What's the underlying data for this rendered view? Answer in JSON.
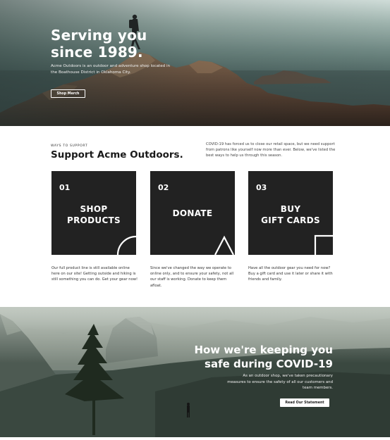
{
  "hero": {
    "title_line1": "Serving you",
    "title_line2": "since 1989.",
    "description": "Acme Outdoors is an outdoor and adventure shop located in the Boathouse District in Oklahoma City.",
    "button_label": "Shop Merch"
  },
  "support": {
    "eyebrow": "WAYS TO SUPPORT",
    "title": "Support Acme Outdoors.",
    "intro": "COVID-19 has forced us to close our retail space, but we need support from patrons like yourself now more than ever. Below, we've listed the best ways to help us through this season.",
    "cards": [
      {
        "number": "01",
        "label_line1": "SHOP",
        "label_line2": "PRODUCTS",
        "description": "Our full product line is still available online here on our site! Getting outside and hiking is still something you can do. Get your gear now!"
      },
      {
        "number": "02",
        "label_line1": "DONATE",
        "label_line2": "",
        "description": "Since we've changed the way we operate to online only, and to ensure your safety, not all our staff is working. Donate to keep them afloat."
      },
      {
        "number": "03",
        "label_line1": "BUY",
        "label_line2": "GIFT CARDS",
        "description": "Have all the outdoor gear you need for now? Buy a gift card and use it later or share it with friends and family."
      }
    ]
  },
  "covid": {
    "title_line1": "How we're keeping you",
    "title_line2": "safe during COVID-19",
    "description": "As an outdoor shop, we've taken precautionary measures to ensure the safety of all our customers and team members.",
    "button_label": "Read Our Statement"
  },
  "colors": {
    "card_background": "#222222",
    "text_dark": "#1a1a1a",
    "hero_overlay_text": "#ffffff"
  },
  "icons": {
    "card1_shape": "half-circle-outline",
    "card2_shape": "triangle-outline",
    "card3_shape": "square-outline"
  }
}
